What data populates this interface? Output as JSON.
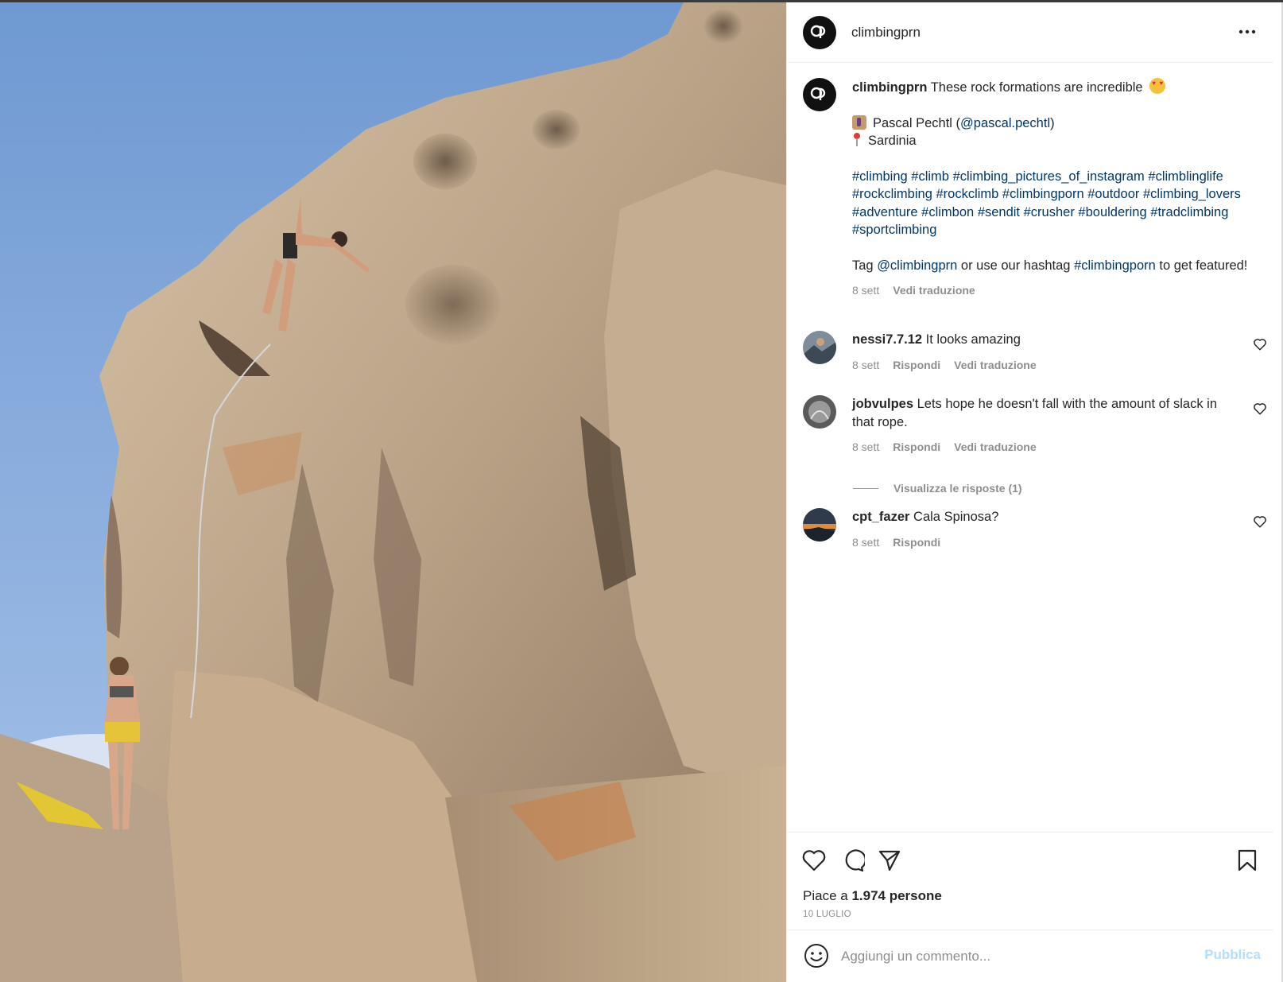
{
  "post": {
    "username": "climbingprn",
    "more_icon": "more-horizontal-icon"
  },
  "caption": {
    "username": "climbingprn",
    "text": "These rock formations are incredible",
    "credit_name": "Pascal Pechtl (",
    "credit_handle": "@pascal.pechtl",
    "credit_close": ")",
    "location": "Sardinia",
    "hashtags": [
      "#climbing",
      "#climb",
      "#climbing_pictures_of_instagram",
      "#climblinglife",
      "#rockclimbing",
      "#rockclimb",
      "#climbingporn",
      "#outdoor",
      "#climbing_lovers",
      "#adventure",
      "#climbon",
      "#sendit",
      "#crusher",
      "#bouldering",
      "#tradclimbing",
      "#sportclimbing"
    ],
    "tag_prefix": "Tag ",
    "tag_handle": "@climbingprn",
    "tag_middle": " or use our hashtag ",
    "tag_hashtag": "#climbingporn",
    "tag_suffix": " to get featured!",
    "time": "8 sett",
    "translate": "Vedi traduzione"
  },
  "comments": [
    {
      "username": "nessi7.7.12",
      "text": "It looks amazing",
      "time": "8 sett",
      "reply": "Rispondi",
      "translate": "Vedi traduzione"
    },
    {
      "username": "jobvulpes",
      "text": "Lets hope he doesn't fall with the amount of slack in that rope.",
      "time": "8 sett",
      "reply": "Rispondi",
      "translate": "Vedi traduzione"
    },
    {
      "username": "cpt_fazer",
      "text": "Cala Spinosa?",
      "time": "8 sett",
      "reply": "Rispondi"
    }
  ],
  "view_replies": "Visualizza le risposte (1)",
  "likes": {
    "prefix": "Piace a ",
    "count": "1.974 persone"
  },
  "date": "10 LUGLIO",
  "add_comment": {
    "placeholder": "Aggiungi un commento...",
    "publish": "Pubblica"
  },
  "colors": {
    "link": "#00376b",
    "muted": "#8e8e8e",
    "publish_disabled": "#b2dffc",
    "text": "#262626"
  }
}
